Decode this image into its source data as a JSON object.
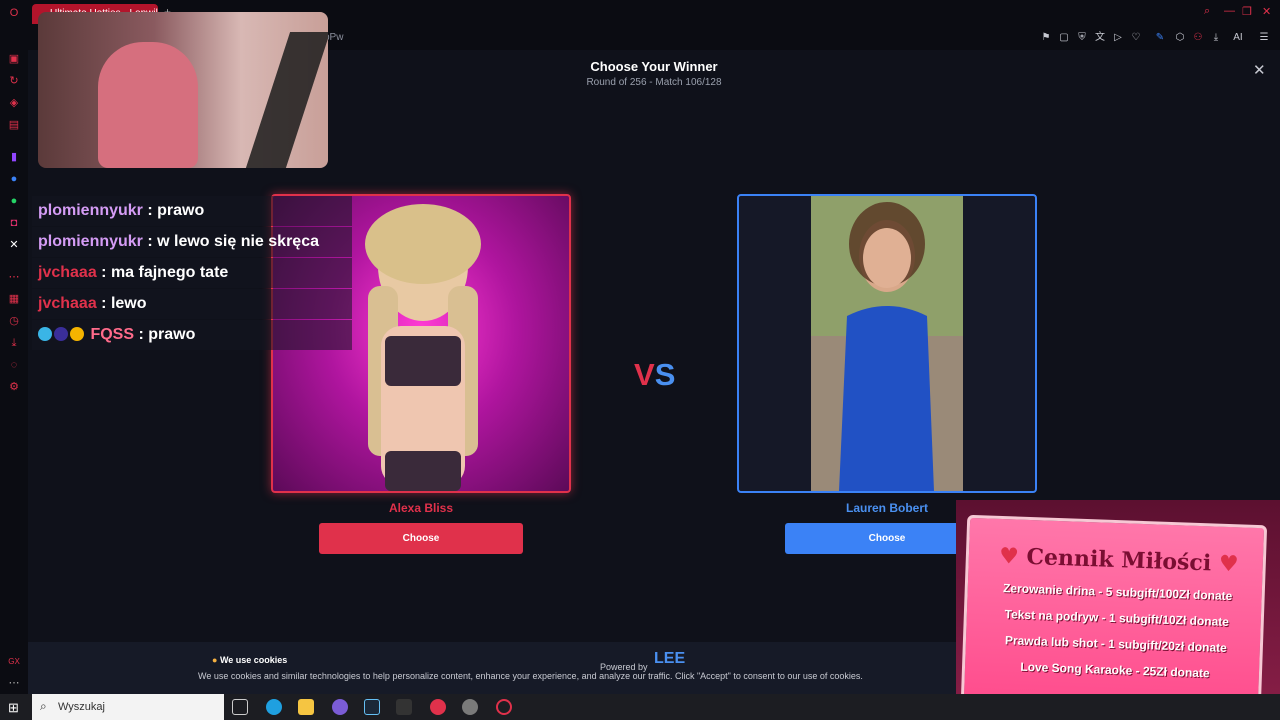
{
  "browser": {
    "tab_title": "Ultimate Hotties - Lopwik",
    "url_fragment": "pPw",
    "ai_label": "AI"
  },
  "page": {
    "title": "Choose Your Winner",
    "subtitle": "Round of 256 - Match 106/128",
    "close_symbol": "✕",
    "vs_v": "V",
    "vs_s": "S",
    "left": {
      "name": "Alexa Bliss",
      "button": "Choose"
    },
    "right": {
      "name": "Lauren Bobert",
      "button": "Choose"
    }
  },
  "cookie": {
    "title": "We use cookies",
    "text": "We use cookies and similar technologies to help personalize content, enhance your experience, and analyze our traffic. Click \"Accept\" to consent to our use of cookies.",
    "powered": "Powered by",
    "logo": "LEE"
  },
  "chat": [
    {
      "user": "plomiennyukr",
      "msg": "prawo",
      "color": "#d59cf5"
    },
    {
      "user": "plomiennyukr",
      "msg": "w lewo się nie skręca",
      "color": "#d59cf5"
    },
    {
      "user": "jvchaaa",
      "msg": "ma fajnego tate",
      "color": "#e0314b"
    },
    {
      "user": "jvchaaa",
      "msg": "lewo",
      "color": "#e0314b"
    },
    {
      "user": "FQSS",
      "msg": "prawo",
      "color": "#ff6b8b"
    }
  ],
  "pricelist": {
    "title": "Cennik Miłości",
    "lines": [
      "Zerowanie drina - 5 subgift/100Zł donate",
      "Tekst na podryw - 1 subgift/10Zł donate",
      "Prawda lub shot - 1 subgift/20zł donate",
      "Love Song Karaoke - 25Zł donate"
    ]
  },
  "taskbar": {
    "search_placeholder": "Wyszukaj"
  },
  "colors": {
    "accent_red": "#e0314b",
    "accent_blue": "#3b82f6",
    "background": "#0f111a"
  }
}
